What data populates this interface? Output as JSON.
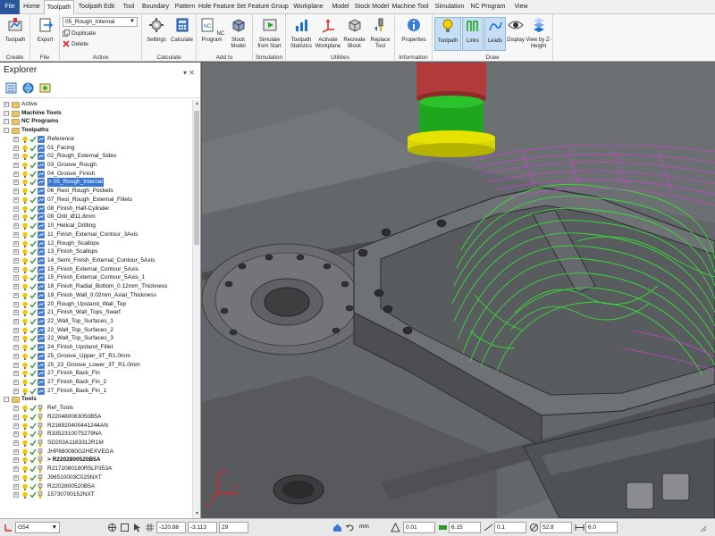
{
  "ribbon_tabs": [
    "File",
    "Home",
    "Toolpath",
    "Toolpath Edit",
    "Tool",
    "Boundary",
    "Pattern",
    "Hole Feature Set",
    "Feature Group",
    "Workplane",
    "Model",
    "Stock Model",
    "Machine Tool",
    "Simulation",
    "NC Program",
    "View"
  ],
  "ribbon": {
    "create": {
      "label": "Create",
      "toolpath": "Toolpath"
    },
    "file": {
      "label": "File",
      "export": "Export"
    },
    "active": {
      "label": "Active",
      "combo_value": "05_Rough_Internal",
      "duplicate": "Duplicate",
      "delete": "Delete"
    },
    "calculate": {
      "label": "Calculate",
      "settings": "Settings",
      "calculate": "Calculate"
    },
    "add_to": {
      "label": "Add to",
      "nc_program": "NC Program",
      "stock_model": "Stock Model"
    },
    "simulation": {
      "label": "Simulation",
      "simulate": "Simulate from Start"
    },
    "utilities": {
      "label": "Utilities",
      "statistics": "Toolpath Statistics",
      "activate": "Activate Workplane",
      "recreate": "Recreate Block",
      "replace": "Replace Tool"
    },
    "information": {
      "label": "Information",
      "properties": "Properties"
    },
    "draw": {
      "label": "Draw",
      "toolpath": "Toolpath",
      "links": "Links",
      "leads": "Leads",
      "display": "Display",
      "view_z": "View by Z-Height"
    }
  },
  "explorer": {
    "title": "Explorer",
    "tree": [
      {
        "label": "Active",
        "level": 0,
        "bold": false
      },
      {
        "label": "Machine Tools",
        "level": 0,
        "bold": true
      },
      {
        "label": "NC Programs",
        "level": 0,
        "bold": true
      },
      {
        "label": "Toolpaths",
        "level": 0,
        "bold": true
      },
      {
        "label": "Reference",
        "level": 1
      },
      {
        "label": "01_Facing",
        "level": 1
      },
      {
        "label": "02_Rough_External_Sides",
        "level": 1
      },
      {
        "label": "03_Groove_Rough",
        "level": 1
      },
      {
        "label": "04_Groove_Finish",
        "level": 1
      },
      {
        "label": "> 05_Rough_Internal",
        "level": 1,
        "selected": true
      },
      {
        "label": "06_Rest_Rough_Pockets",
        "level": 1
      },
      {
        "label": "07_Rest_Rough_External_Fillets",
        "level": 1
      },
      {
        "label": "08_Finish_Half-Cylinder",
        "level": 1
      },
      {
        "label": "09_Drill_Ø11.8mm",
        "level": 1
      },
      {
        "label": "10_Helical_Drilling",
        "level": 1
      },
      {
        "label": "11_Finish_External_Contour_3Axis",
        "level": 1
      },
      {
        "label": "12_Rough_Scallops",
        "level": 1
      },
      {
        "label": "13_Finish_Scallops",
        "level": 1
      },
      {
        "label": "14_Semi_Finish_External_Contour_5Axis",
        "level": 1
      },
      {
        "label": "15_Finish_External_Contour_5Axis",
        "level": 1
      },
      {
        "label": "15_Finish_External_Contour_5Axis_1",
        "level": 1
      },
      {
        "label": "18_Finish_Radial_Bottom_0.12mm_Thickness",
        "level": 1
      },
      {
        "label": "19_Finish_Wall_0.02mm_Axial_Thickness",
        "level": 1
      },
      {
        "label": "20_Rough_Upstand_Wall_Top",
        "level": 1
      },
      {
        "label": "21_Finish_Wall_Tops_Swarf",
        "level": 1
      },
      {
        "label": "22_Wall_Top_Surfaces_1",
        "level": 1
      },
      {
        "label": "22_Wall_Top_Surfaces_2",
        "level": 1
      },
      {
        "label": "22_Wall_Top_Surfaces_3",
        "level": 1
      },
      {
        "label": "24_Finish_Upstand_Fillet",
        "level": 1
      },
      {
        "label": "25_Groove_Upper_3T_R1.0mm",
        "level": 1
      },
      {
        "label": "25_23_Groove_Lower_3T_R1.0mm",
        "level": 1
      },
      {
        "label": "27_Finish_Back_Fin",
        "level": 1
      },
      {
        "label": "27_Finish_Back_Fin_2",
        "level": 1
      },
      {
        "label": "27_Finish_Back_Fin_1",
        "level": 1
      },
      {
        "label": "Tools",
        "level": 0,
        "bold": true
      },
      {
        "label": "Ref_Tools",
        "level": 1
      },
      {
        "label": "R220480063050B5A",
        "level": 1
      },
      {
        "label": "R216920400441244AN",
        "level": 1
      },
      {
        "label": "R3352310075279NA",
        "level": 1
      },
      {
        "label": "SD203A1183312R1M",
        "level": 1
      },
      {
        "label": "JHP880080G2HEXVEGA",
        "level": 1
      },
      {
        "label": "> R2202800520B5A",
        "level": 1,
        "bold": true
      },
      {
        "label": "R2172080180R5LP353A",
        "level": 1
      },
      {
        "label": "J96510003C025NXT",
        "level": 1
      },
      {
        "label": "R2202800520B5A",
        "level": 1
      },
      {
        "label": "15730700152NXT",
        "level": 1
      }
    ]
  },
  "statusbar": {
    "workplane": "G54",
    "x": "-120.88",
    "y": "-3.113",
    "z": "29",
    "units": "mm",
    "tolerance": "0.01",
    "thickness": "6.15",
    "stepover": "0.1",
    "diameter": "52.8",
    "length": "6.0"
  },
  "colors": {
    "toolpath_green": "#35e035",
    "toolpath_magenta": "#d040d8",
    "tool_holder_red": "#b33a3a",
    "tool_body_green": "#1fa61f",
    "tool_tip_yellow": "#d8d400",
    "selection": "#3a78d8"
  }
}
